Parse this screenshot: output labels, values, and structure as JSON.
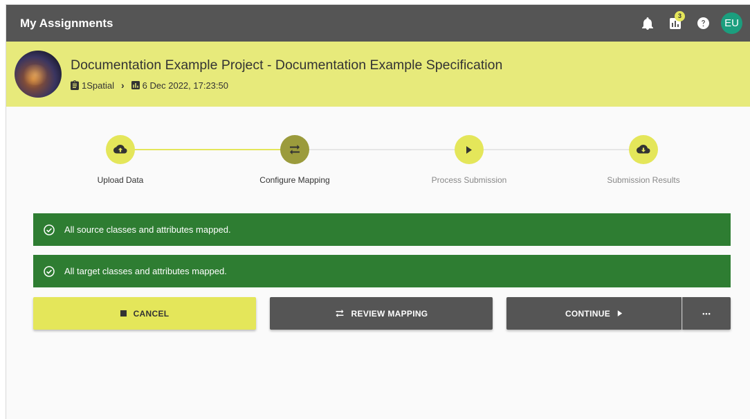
{
  "appbar": {
    "title": "My Assignments",
    "notification_badge": "3",
    "avatar_initials": "EU"
  },
  "project": {
    "title": "Documentation Example Project - Documentation Example Specification",
    "breadcrumb_owner": "1Spatial",
    "breadcrumb_date": "6 Dec 2022, 17:23:50"
  },
  "stepper": {
    "steps": [
      {
        "label": "Upload Data",
        "icon": "cloud-upload-icon",
        "state": "done"
      },
      {
        "label": "Configure Mapping",
        "icon": "swap-arrows-icon",
        "state": "active"
      },
      {
        "label": "Process Submission",
        "icon": "play-icon",
        "state": "todo"
      },
      {
        "label": "Submission Results",
        "icon": "cloud-download-icon",
        "state": "todo"
      }
    ]
  },
  "alerts": [
    {
      "text": "All source classes and attributes mapped."
    },
    {
      "text": "All target classes and attributes mapped."
    }
  ],
  "actions": {
    "cancel_label": "CANCEL",
    "review_label": "REVIEW MAPPING",
    "continue_label": "CONTINUE",
    "more_label": "•••"
  },
  "colors": {
    "appbar": "#555555",
    "header_accent": "#e7ea7b",
    "step_circle": "#e4e65a",
    "step_active": "#9b9b3c",
    "success": "#2e7d32",
    "avatar": "#1b9e7e"
  }
}
